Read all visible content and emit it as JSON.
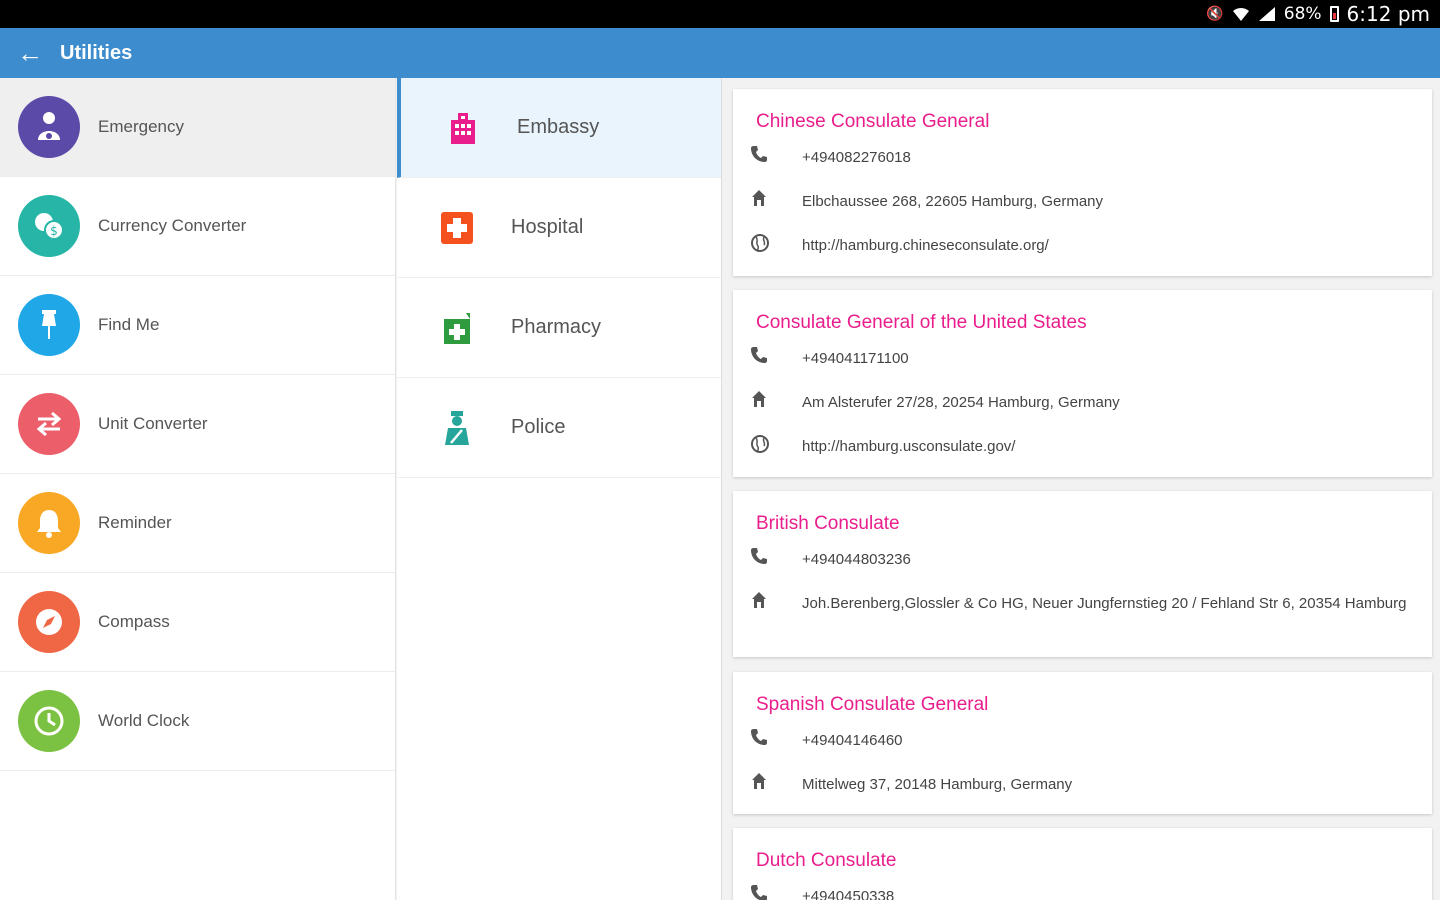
{
  "status_bar": {
    "battery": "68%",
    "time": "6:12 pm"
  },
  "app_bar": {
    "title": "Utilities"
  },
  "utilities": [
    {
      "label": "Emergency",
      "color": "#5b4aa8",
      "icon": "emergency-icon",
      "active": true
    },
    {
      "label": "Currency Converter",
      "color": "#26b5a6",
      "icon": "currency-icon"
    },
    {
      "label": "Find Me",
      "color": "#1fa7e8",
      "icon": "pin-icon"
    },
    {
      "label": "Unit Converter",
      "color": "#ec5f6a",
      "icon": "swap-arrows-icon"
    },
    {
      "label": "Reminder",
      "color": "#f9a825",
      "icon": "bell-icon"
    },
    {
      "label": "Compass",
      "color": "#ef6744",
      "icon": "compass-icon"
    },
    {
      "label": "World Clock",
      "color": "#7cc242",
      "icon": "clock-icon"
    }
  ],
  "categories": [
    {
      "label": "Embassy",
      "icon": "building-icon",
      "color": "#e91e8c",
      "active": true
    },
    {
      "label": "Hospital",
      "icon": "hospital-cross-icon",
      "color": "#f4511e"
    },
    {
      "label": "Pharmacy",
      "icon": "pharmacy-icon",
      "color": "#2e9b3e"
    },
    {
      "label": "Police",
      "icon": "police-officer-icon",
      "color": "#26a69a"
    }
  ],
  "embassies": [
    {
      "name": "Chinese Consulate General",
      "phone": "+494082276018",
      "address": "Elbchaussee 268, 22605 Hamburg, Germany",
      "website": "http://hamburg.chineseconsulate.org/"
    },
    {
      "name": "Consulate General of the United States",
      "phone": "+494041171100",
      "address": "Am Alsterufer 27/28, 20254 Hamburg, Germany",
      "website": "http://hamburg.usconsulate.gov/"
    },
    {
      "name": "British Consulate",
      "phone": "+494044803236",
      "address": "Joh.Berenberg,Glossler & Co HG,  Neuer Jungfernstieg 20 / Fehland Str 6, 20354 Hamburg"
    },
    {
      "name": "Spanish Consulate General",
      "phone": "+49404146460",
      "address": "Mittelweg 37, 20148 Hamburg, Germany"
    },
    {
      "name": "Dutch Consulate",
      "phone": "+4940450338"
    }
  ]
}
